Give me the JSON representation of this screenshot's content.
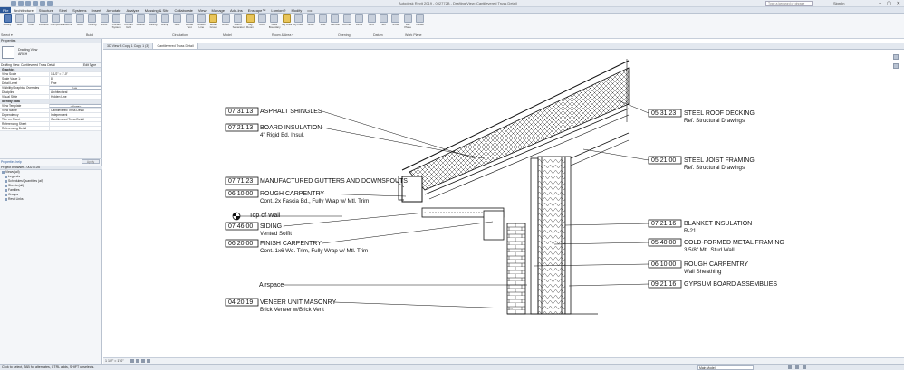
{
  "app": {
    "title": "Autodesk Revit 2019 - 002772B - Drafting View: Cantilevered Truss Detail",
    "search_placeholder": "Type a keyword or phrase",
    "user": "Sign In",
    "window_buttons": [
      "–",
      "▢",
      "✕"
    ]
  },
  "ribbon_tabs": [
    "File",
    "Architecture",
    "Structure",
    "Steel",
    "Systems",
    "Insert",
    "Annotate",
    "Analyze",
    "Massing & Site",
    "Collaborate",
    "View",
    "Manage",
    "Add-Ins",
    "Enscape™",
    "Lumion®",
    "Modify",
    "▭•"
  ],
  "ribbon_tools": [
    {
      "label": "Modify"
    },
    {
      "label": "Wall"
    },
    {
      "label": "Door"
    },
    {
      "label": "Window"
    },
    {
      "label": "Component"
    },
    {
      "label": "Column"
    },
    {
      "label": "Roof"
    },
    {
      "label": "Ceiling"
    },
    {
      "label": "Floor"
    },
    {
      "label": "Curtain System"
    },
    {
      "label": "Curtain Grid"
    },
    {
      "label": "Mullion"
    },
    {
      "label": "Railing"
    },
    {
      "label": "Ramp"
    },
    {
      "label": "Stair"
    },
    {
      "label": "Model Text"
    },
    {
      "label": "Model Line"
    },
    {
      "label": "Model Group"
    },
    {
      "label": "Room"
    },
    {
      "label": "Room Separator"
    },
    {
      "label": "Tag Room"
    },
    {
      "label": "Area"
    },
    {
      "label": "Area Boundary"
    },
    {
      "label": "Tag Area"
    },
    {
      "label": "By Face"
    },
    {
      "label": "Shaft"
    },
    {
      "label": "Wall"
    },
    {
      "label": "Vertical"
    },
    {
      "label": "Dormer"
    },
    {
      "label": "Level"
    },
    {
      "label": "Grid"
    },
    {
      "label": "Set"
    },
    {
      "label": "Show"
    },
    {
      "label": "Ref Plane"
    },
    {
      "label": "Viewer"
    }
  ],
  "ribbon_panels": [
    "Select ▾",
    "Build",
    "Circulation",
    "Model",
    "Room & Area ▾",
    "Opening",
    "Datum",
    "Work Plane"
  ],
  "doc_tabs": [
    "3D View 8 Copy 1 Copy 1 (3)",
    "Cantilevered Truss Detail"
  ],
  "properties": {
    "header": "Properties",
    "type_name": "Drafting View\nARCH",
    "selector_value": "Drafting View: Cantilevered Truss Detail",
    "edit_type": "Edit Type",
    "rows": [
      {
        "k": "Graphics",
        "v": "",
        "group": true
      },
      {
        "k": "View Scale",
        "v": "1 1/2\" = 1'-0\""
      },
      {
        "k": "Scale Value 1:",
        "v": "8"
      },
      {
        "k": "Detail Level",
        "v": "Fine"
      },
      {
        "k": "Visibility/Graphics Overrides",
        "v": "Edit..."
      },
      {
        "k": "Discipline",
        "v": "Architectural"
      },
      {
        "k": "Visual Style",
        "v": "Hidden Line"
      },
      {
        "k": "Identity Data",
        "v": "",
        "group": true
      },
      {
        "k": "View Template",
        "v": "<None>"
      },
      {
        "k": "View Name",
        "v": "Cantilevered Truss Detail"
      },
      {
        "k": "Dependency",
        "v": "Independent"
      },
      {
        "k": "Title on Sheet",
        "v": "Cantilevered Truss Detail"
      },
      {
        "k": "Referencing Sheet",
        "v": ""
      },
      {
        "k": "Referencing Detail",
        "v": ""
      }
    ],
    "help": "Properties help",
    "apply": "Apply"
  },
  "project_browser": {
    "header": "Project Browser - 002772B",
    "items": [
      "Views (all)",
      "Legends",
      "Schedules/Quantities (all)",
      "Sheets (all)",
      "Families",
      "Groups",
      "Revit Links"
    ]
  },
  "view_bar": {
    "scale": "1 1/2\" = 1'-0\""
  },
  "status": {
    "message": "Click to select, TAB for alternates, CTRL adds, SHIFT unselects.",
    "model": "Main Model"
  },
  "keynotes_left": [
    {
      "code": "07 31 13",
      "title": "ASPHALT SHINGLES",
      "sub": ""
    },
    {
      "code": "07 21 13",
      "title": "BOARD INSULATION",
      "sub": "4\" Rigid Bd. Insul."
    },
    {
      "code": "07 71 23",
      "title": "MANUFACTURED GUTTERS AND DOWNSPOUTS",
      "sub": ""
    },
    {
      "code": "06 10 00",
      "title": "ROUGH CARPENTRY",
      "sub": "Cont. 2x Fascia Bd., Fully Wrap w/ Mtl. Trim"
    },
    {
      "code": "07 46 00",
      "title": "SIDING",
      "sub": "Vented Soffit"
    },
    {
      "code": "06 20 00",
      "title": "FINISH CARPENTRY",
      "sub": "Cont. 1x6 Wd. Trim, Fully Wrap w/ Mtl. Trim"
    },
    {
      "code": "04 20 19",
      "title": "VENEER UNIT MASONRY",
      "sub": "Brick Veneer w/Brick Vent"
    }
  ],
  "keynotes_right": [
    {
      "code": "05 31 23",
      "title": "STEEL ROOF DECKING",
      "sub": "Ref. Structural Drawings"
    },
    {
      "code": "05 21 00",
      "title": "STEEL JOIST FRAMING",
      "sub": "Ref. Structural Drawings"
    },
    {
      "code": "07 21 16",
      "title": "BLANKET INSULATION",
      "sub": "R-21"
    },
    {
      "code": "05 40 00",
      "title": "COLD-FORMED METAL FRAMING",
      "sub": "3 5/8\" Mtl. Stud Wall"
    },
    {
      "code": "06 10 00",
      "title": "ROUGH CARPENTRY",
      "sub": "Wall Sheathing"
    },
    {
      "code": "09 21 16",
      "title": "GYPSUM BOARD ASSEMBLIES",
      "sub": ""
    }
  ],
  "annotations": {
    "top_of_wall": "Top of Wall",
    "airspace": "Airspace"
  },
  "colors": {
    "accent": "#2b5797",
    "ribbon_bg": "#f4f6f9",
    "canvas_bg": "#ffffff"
  }
}
